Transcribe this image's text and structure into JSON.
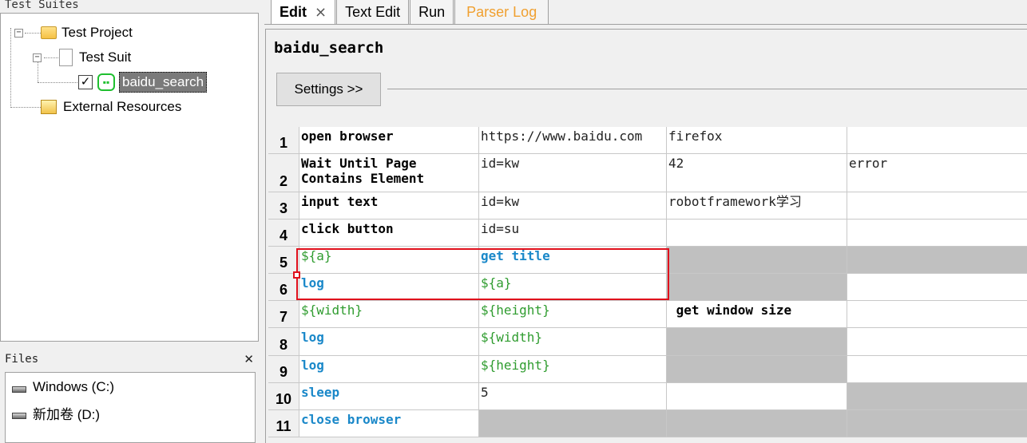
{
  "left": {
    "suites_header": "Test Suites",
    "tree": {
      "project": "Test Project",
      "suite": "Test Suit",
      "testcase": "baidu_search",
      "external": "External Resources"
    },
    "files_header": "Files",
    "files_close": "✕",
    "drives": [
      "Windows (C:)",
      "新加卷 (D:)"
    ]
  },
  "tabs": [
    {
      "label": "Edit",
      "close": "⨯",
      "active": true
    },
    {
      "label": "Text Edit"
    },
    {
      "label": "Run"
    },
    {
      "label": "Parser Log",
      "color": "#f0a030"
    }
  ],
  "editor": {
    "title": "baidu_search",
    "settings_label": "Settings >>"
  },
  "grid_rows": [
    {
      "num": "1",
      "cells": [
        "open browser",
        "https://www.baidu.com",
        "firefox",
        ""
      ]
    },
    {
      "num": "2",
      "cells": [
        "Wait Until Page\nContains Element",
        "id=kw",
        "42",
        "error"
      ]
    },
    {
      "num": "3",
      "cells": [
        "input text",
        "id=kw",
        "robotframework学习",
        ""
      ]
    },
    {
      "num": "4",
      "cells": [
        "click button",
        "id=su",
        "",
        ""
      ]
    },
    {
      "num": "5",
      "cells": [
        "${a}",
        "get title",
        "",
        ""
      ]
    },
    {
      "num": "6",
      "cells": [
        "log",
        "${a}",
        "",
        ""
      ]
    },
    {
      "num": "7",
      "cells": [
        "${width}",
        "${height}",
        " get window size",
        ""
      ]
    },
    {
      "num": "8",
      "cells": [
        "log",
        "${width}",
        "",
        ""
      ]
    },
    {
      "num": "9",
      "cells": [
        "log",
        "${height}",
        "",
        ""
      ]
    },
    {
      "num": "10",
      "cells": [
        "sleep",
        "5",
        "",
        ""
      ]
    },
    {
      "num": "11",
      "cells": [
        "close browser",
        "",
        "",
        ""
      ]
    }
  ],
  "colors": {
    "keyword_blue": "#1a88c9",
    "variable_green": "#2f9c2f",
    "highlight_red": "#e0101c",
    "disabled_gray": "#c0c0c0"
  }
}
